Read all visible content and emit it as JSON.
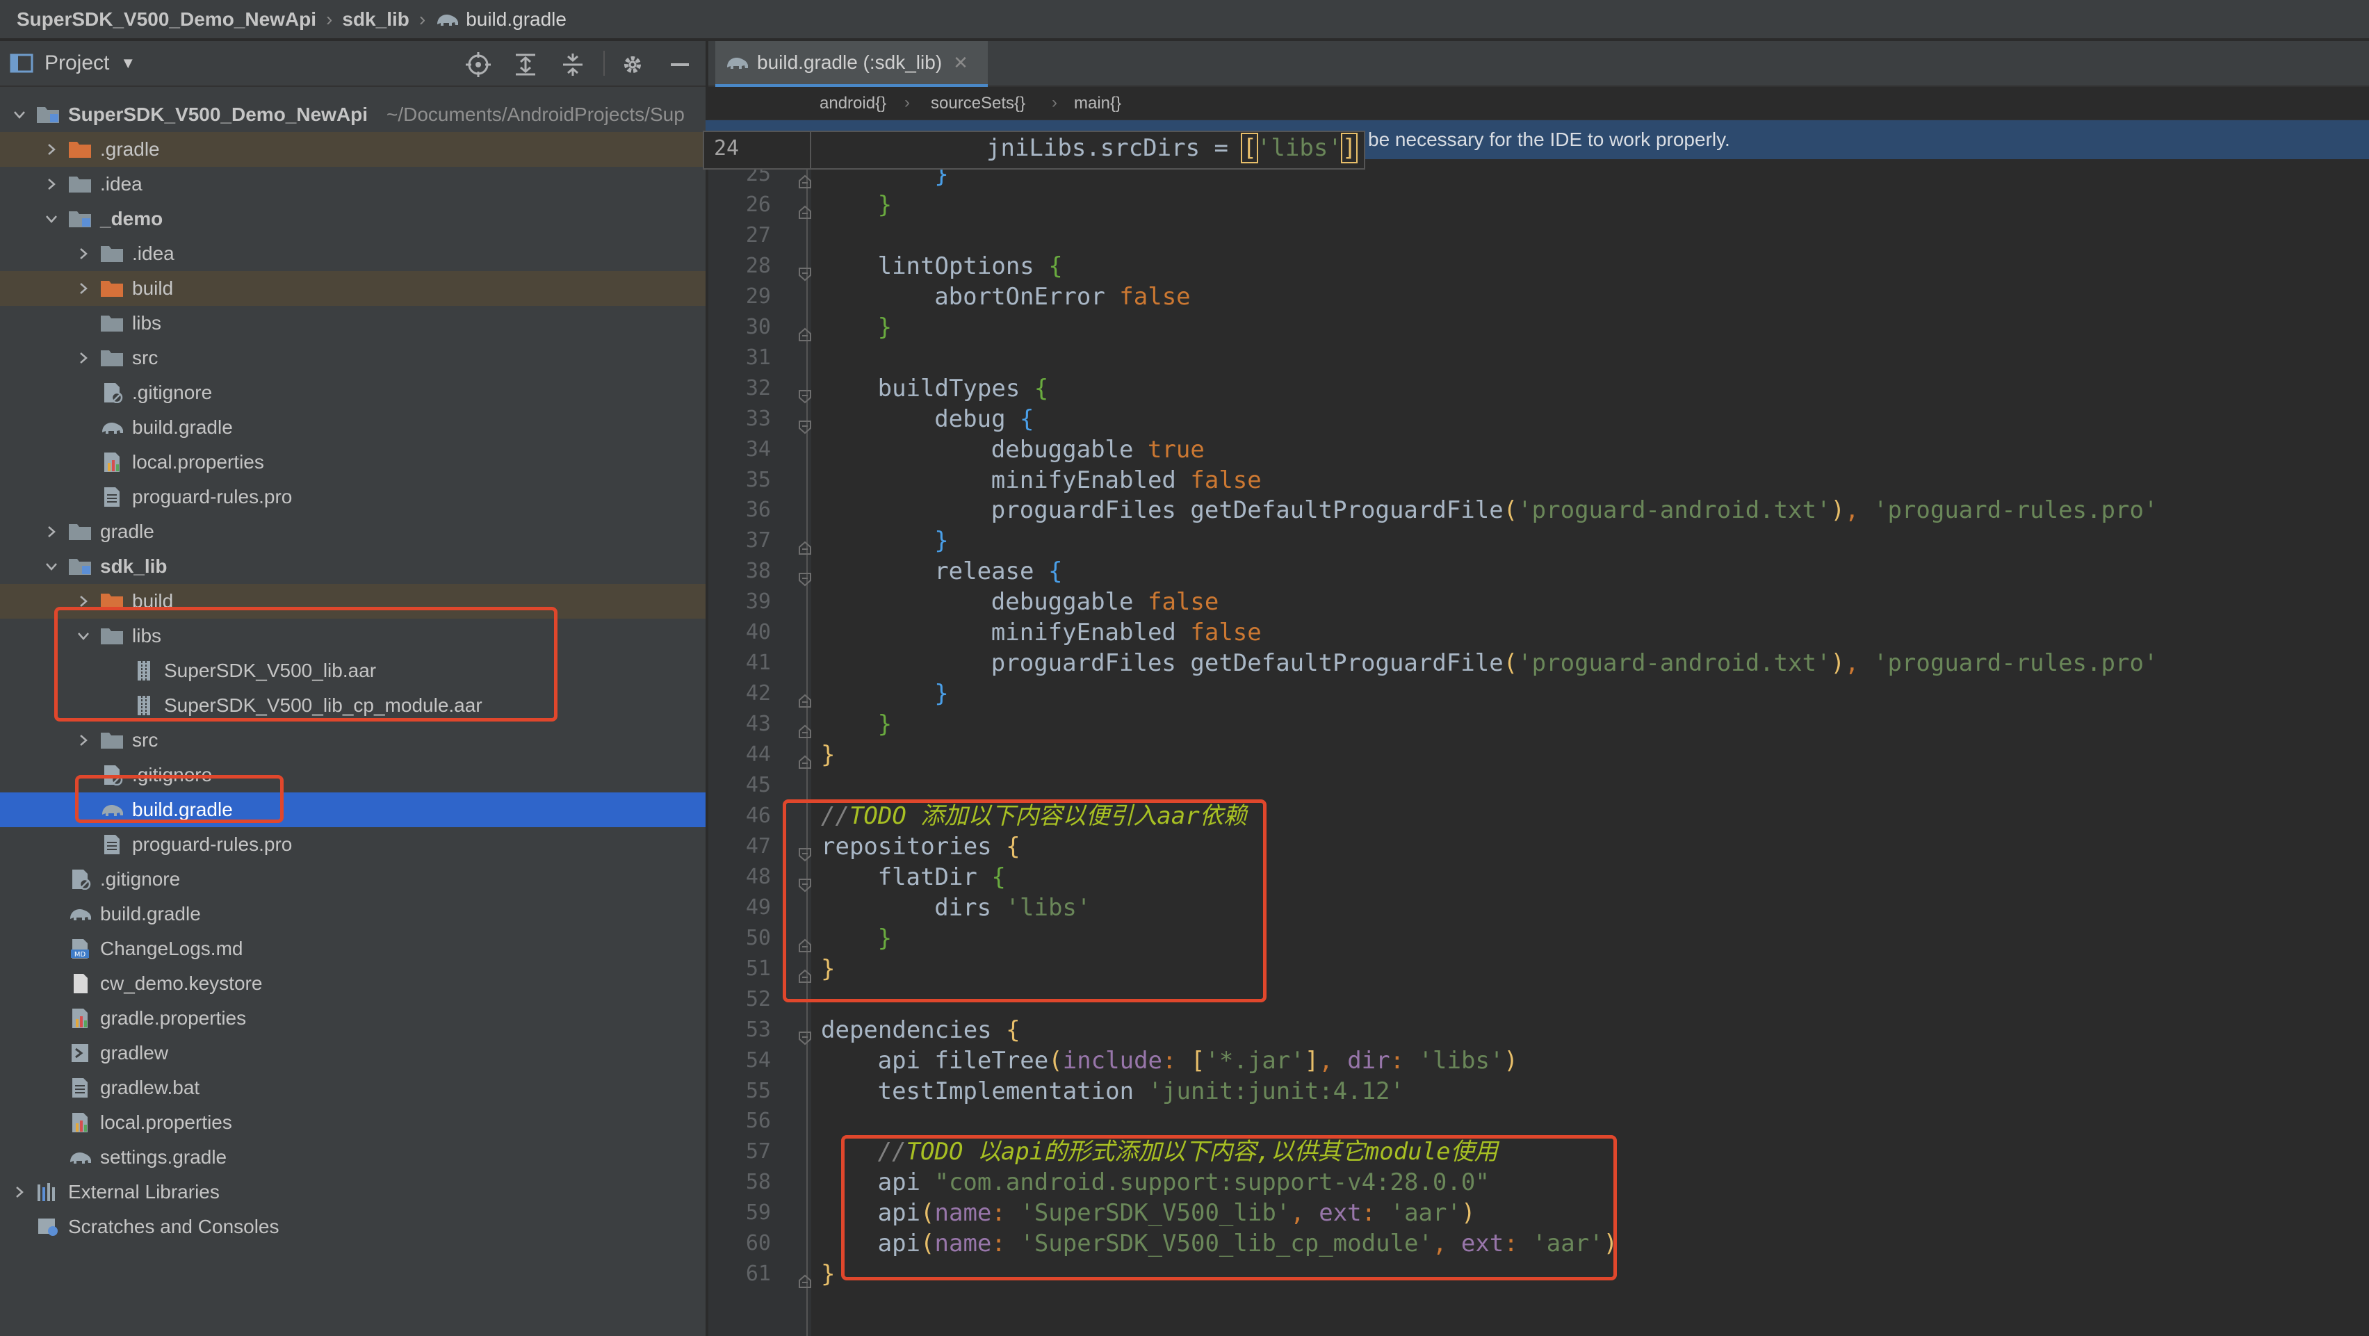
{
  "breadcrumb": {
    "project": "SuperSDK_V500_Demo_NewApi",
    "module": "sdk_lib",
    "file": "build.gradle"
  },
  "sidebar": {
    "title": "Project",
    "items": [
      {
        "label": "SuperSDK_V500_Demo_NewApi",
        "path": "~/Documents/AndroidProjects/Sup"
      },
      {
        "label": ".gradle"
      },
      {
        "label": ".idea"
      },
      {
        "label": "_demo"
      },
      {
        "label": ".idea"
      },
      {
        "label": "build"
      },
      {
        "label": "libs"
      },
      {
        "label": "src"
      },
      {
        "label": ".gitignore"
      },
      {
        "label": "build.gradle"
      },
      {
        "label": "local.properties"
      },
      {
        "label": "proguard-rules.pro"
      },
      {
        "label": "gradle"
      },
      {
        "label": "sdk_lib"
      },
      {
        "label": "build"
      },
      {
        "label": "libs"
      },
      {
        "label": "SuperSDK_V500_lib.aar"
      },
      {
        "label": "SuperSDK_V500_lib_cp_module.aar"
      },
      {
        "label": "src"
      },
      {
        "label": ".gitignore"
      },
      {
        "label": "build.gradle"
      },
      {
        "label": "proguard-rules.pro"
      },
      {
        "label": ".gitignore"
      },
      {
        "label": "build.gradle"
      },
      {
        "label": "ChangeLogs.md"
      },
      {
        "label": "cw_demo.keystore"
      },
      {
        "label": "gradle.properties"
      },
      {
        "label": "gradlew"
      },
      {
        "label": "gradlew.bat"
      },
      {
        "label": "local.properties"
      },
      {
        "label": "settings.gradle"
      },
      {
        "label": "External Libraries"
      },
      {
        "label": "Scratches and Consoles"
      }
    ]
  },
  "editor": {
    "tab_label": "build.gradle (:sdk_lib)",
    "crumbs": [
      "android{}",
      "sourceSets{}",
      "main{}"
    ],
    "notice": "be necessary for the IDE to work properly.",
    "sticky": {
      "num": "24",
      "a": "jniLibs.srcDirs = ",
      "b": "[",
      "c": "'libs'",
      "d": "]"
    },
    "lines": {
      "25": "}",
      "26": "}",
      "28a": "lintOptions ",
      "28b": "{",
      "29a": "abortOnError ",
      "29b": "false",
      "30": "}",
      "32a": "buildTypes ",
      "32b": "{",
      "33a": "debug ",
      "33b": "{",
      "34a": "debuggable ",
      "34b": "true",
      "35a": "minifyEnabled ",
      "35b": "false",
      "36a": "proguardFiles getDefaultProguardFile",
      "36b": "(",
      "36c": "'proguard-android.txt'",
      "36d": ")",
      "36e": ", ",
      "36f": "'proguard-rules.pro'",
      "37": "}",
      "38a": "release ",
      "38b": "{",
      "39a": "debuggable ",
      "39b": "false",
      "40a": "minifyEnabled ",
      "40b": "false",
      "41a": "proguardFiles getDefaultProguardFile",
      "41b": "(",
      "41c": "'proguard-android.txt'",
      "41d": ")",
      "41e": ", ",
      "41f": "'proguard-rules.pro'",
      "42": "}",
      "43": "}",
      "44": "}",
      "46a": "//",
      "46b": "TODO 添加以下内容以便引入aar依赖",
      "47a": "repositories ",
      "47b": "{",
      "48a": "flatDir ",
      "48b": "{",
      "49a": "dirs ",
      "49b": "'libs'",
      "50": "}",
      "51": "}",
      "53a": "dependencies ",
      "53b": "{",
      "54a": "api fileTree",
      "54b": "(",
      "54c": "include",
      "54d": ": ",
      "54e": "[",
      "54f": "'*.jar'",
      "54g": "]",
      "54h": ", ",
      "54i": "dir",
      "54j": ": ",
      "54k": "'libs'",
      "54l": ")",
      "55a": "testImplementation ",
      "55b": "'junit:junit:4.12'",
      "57a": "//",
      "57b": "TODO 以api的形式添加以下内容,以供其它module使用",
      "58a": "api ",
      "58b": "\"com.android.support:support-v4:28.0.0\"",
      "59a": "api",
      "59b": "(",
      "59c": "name",
      "59d": ": ",
      "59e": "'SuperSDK_V500_lib'",
      "59f": ", ",
      "59g": "ext",
      "59h": ": ",
      "59i": "'aar'",
      "59j": ")",
      "60a": "api",
      "60b": "(",
      "60c": "name",
      "60d": ": ",
      "60e": "'SuperSDK_V500_lib_cp_module'",
      "60f": ", ",
      "60g": "ext",
      "60h": ": ",
      "60i": "'aar'",
      "60j": ")",
      "61": "}"
    },
    "line_numbers": [
      "25",
      "26",
      "27",
      "28",
      "29",
      "30",
      "31",
      "32",
      "33",
      "34",
      "35",
      "36",
      "37",
      "38",
      "39",
      "40",
      "41",
      "42",
      "43",
      "44",
      "45",
      "46",
      "47",
      "48",
      "49",
      "50",
      "51",
      "52",
      "53",
      "54",
      "55",
      "56",
      "57",
      "58",
      "59",
      "60",
      "61"
    ]
  }
}
